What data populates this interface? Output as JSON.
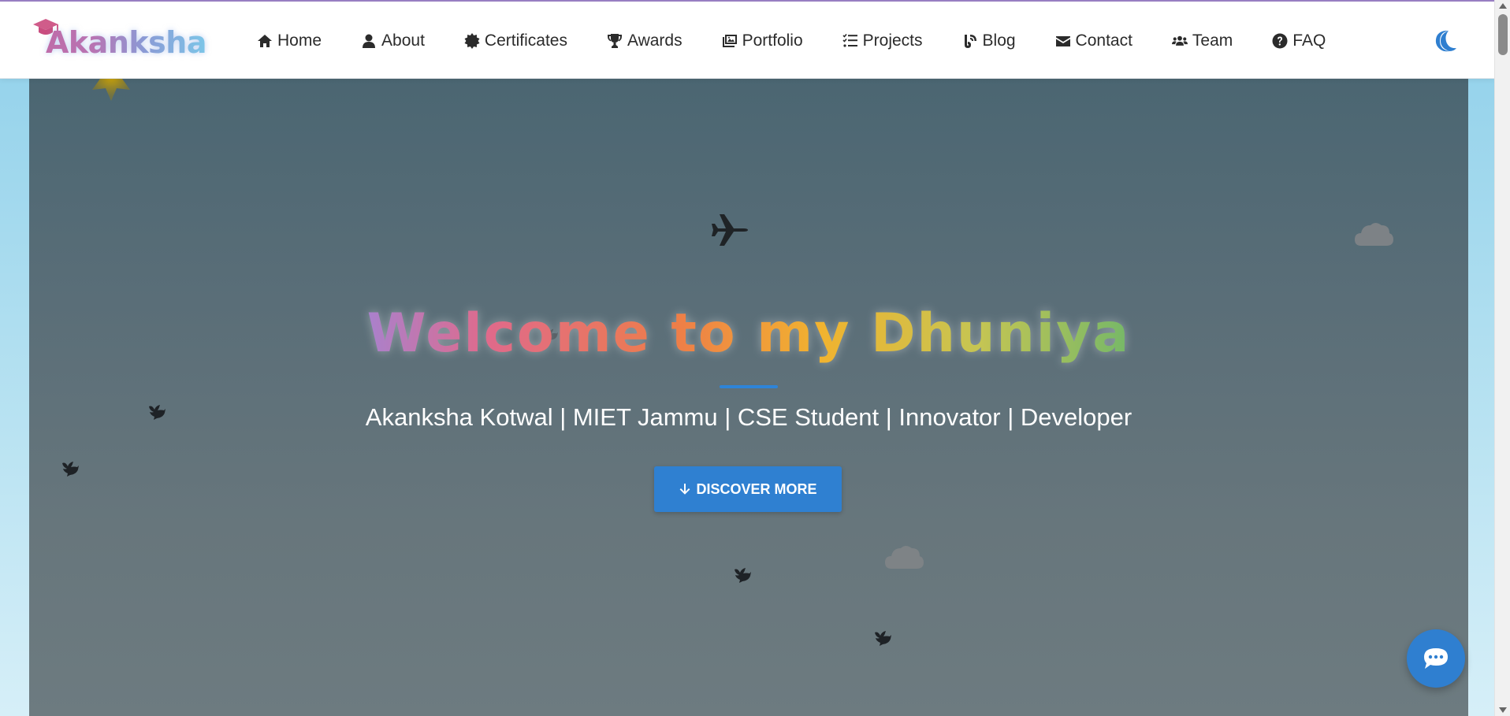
{
  "brand": {
    "name": "Akanksha"
  },
  "nav": {
    "items": [
      {
        "label": "Home",
        "icon": "home-icon"
      },
      {
        "label": "About",
        "icon": "user-icon"
      },
      {
        "label": "Certificates",
        "icon": "certificate-icon"
      },
      {
        "label": "Awards",
        "icon": "trophy-icon"
      },
      {
        "label": "Portfolio",
        "icon": "images-icon"
      },
      {
        "label": "Projects",
        "icon": "tasks-icon"
      },
      {
        "label": "Blog",
        "icon": "blog-icon"
      },
      {
        "label": "Contact",
        "icon": "envelope-icon"
      },
      {
        "label": "Team",
        "icon": "users-icon"
      },
      {
        "label": "FAQ",
        "icon": "question-icon"
      }
    ],
    "theme_toggle_icon": "moon-icon"
  },
  "hero": {
    "title": "Welcome to my Dhuniya",
    "subtitle": "Akanksha Kotwal | MIET Jammu | CSE Student | Innovator | Developer",
    "cta_label": "DISCOVER MORE",
    "cta_icon": "arrow-down-icon"
  },
  "chat": {
    "icon": "chat-icon"
  },
  "colors": {
    "accent": "#2f80d1",
    "hero_bg_top": "#4b6672",
    "hero_bg_bottom": "#6d7b80",
    "page_bg": "#a8dbef"
  }
}
